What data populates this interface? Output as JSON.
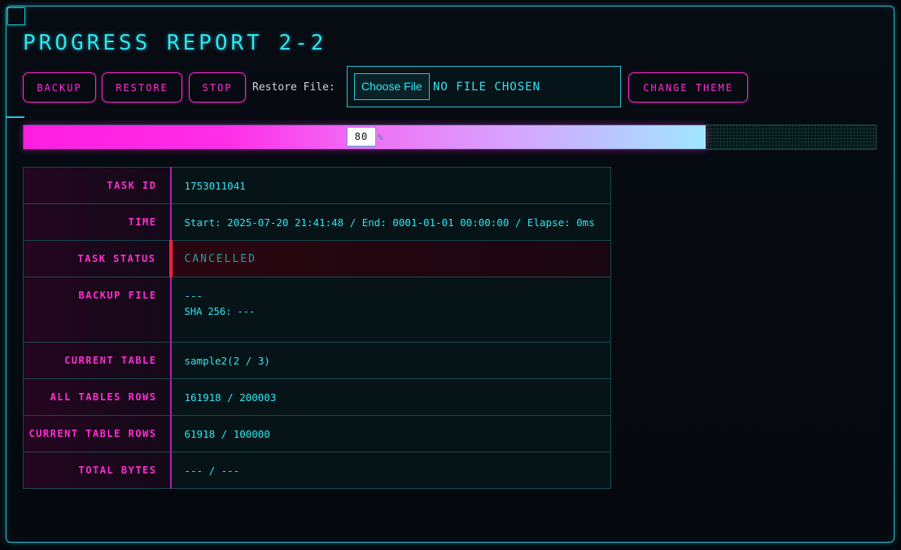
{
  "header": {
    "title": "PROGRESS REPORT 2-2"
  },
  "toolbar": {
    "backup_label": "BACKUP",
    "restore_label": "RESTORE",
    "stop_label": "STOP",
    "restore_file_label": "Restore File:",
    "choose_file_label": "Choose File",
    "no_file_label": "NO FILE CHOSEN",
    "change_theme_label": "CHANGE THEME"
  },
  "progress": {
    "value": "80",
    "percent": 80,
    "unit": "%"
  },
  "details": {
    "task_id_label": "TASK ID",
    "task_id": "1753011041",
    "time_label": "TIME",
    "time": "Start: 2025-07-20 21:41:48 / End: 0001-01-01 00:00:00 / Elapse: 0ms",
    "task_status_label": "TASK STATUS",
    "task_status": "CANCELLED",
    "backup_file_label": "BACKUP FILE",
    "backup_file": "---",
    "sha_256": "SHA 256: ---",
    "current_table_label": "CURRENT TABLE",
    "current_table": "sample2(2 / 3)",
    "all_tables_rows_label": "ALL TABLES ROWS",
    "all_tables_rows": "161918 / 200003",
    "current_table_rows_label": "CURRENT TABLE ROWS",
    "current_table_rows": "61918 / 100000",
    "total_bytes_label": "TOTAL BYTES",
    "total_bytes": "--- / ---"
  },
  "colors": {
    "accent_cyan": "#2ee6f2",
    "accent_magenta": "#ff2ed1",
    "status_cancelled": "#ff1e3c"
  }
}
